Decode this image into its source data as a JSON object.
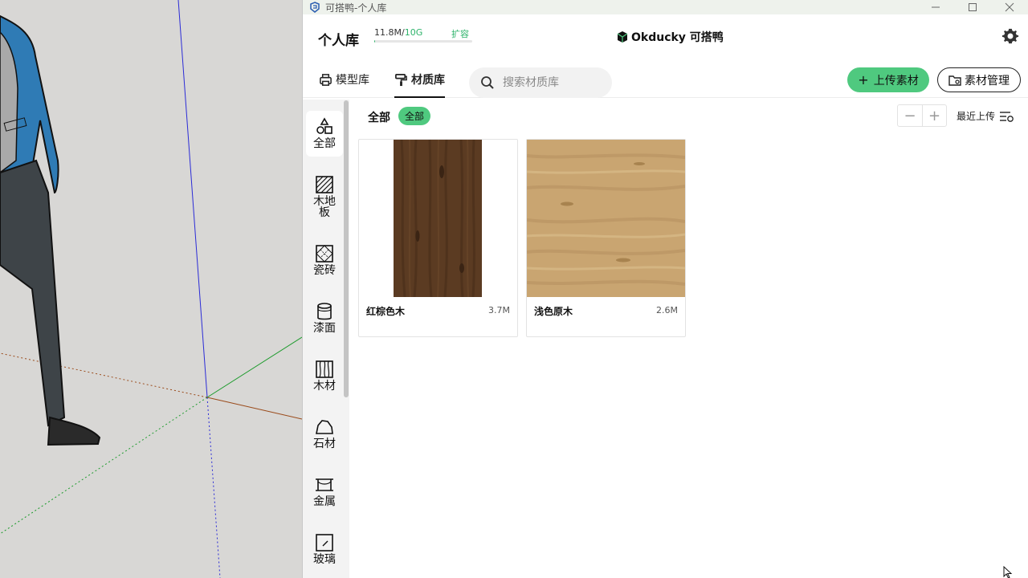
{
  "window": {
    "title": "可搭鸭-个人库",
    "controls": [
      "minimize-icon",
      "maximize-icon",
      "close-icon"
    ]
  },
  "header": {
    "title": "个人库",
    "storage_used": "11.8M",
    "storage_sep": "/",
    "storage_total": "10G",
    "storage_fraction": 0.0012,
    "expand_label": "扩容",
    "logo_text": "Okducky 可搭鸭",
    "settings_icon": "gear-icon"
  },
  "nav": {
    "tabs": [
      {
        "label": "模型库",
        "icon": "printer-icon",
        "active": false
      },
      {
        "label": "材质库",
        "icon": "paint-roller-icon",
        "active": true
      }
    ],
    "search_placeholder": "搜索材质库",
    "upload_label": "上传素材",
    "manage_label": "素材管理"
  },
  "sidebar": {
    "categories": [
      {
        "label": "全部",
        "icon": "shapes-icon",
        "active": true
      },
      {
        "label": "木地板",
        "icon": "wood-floor-icon",
        "active": false
      },
      {
        "label": "瓷砖",
        "icon": "tile-icon",
        "active": false
      },
      {
        "label": "漆面",
        "icon": "paint-can-icon",
        "active": false
      },
      {
        "label": "木材",
        "icon": "wood-grain-icon",
        "active": false
      },
      {
        "label": "石材",
        "icon": "stone-icon",
        "active": false
      },
      {
        "label": "金属",
        "icon": "metal-beam-icon",
        "active": false
      },
      {
        "label": "玻璃",
        "icon": "glass-icon",
        "active": false
      }
    ]
  },
  "content": {
    "filter_title": "全部",
    "filter_chip": "全部",
    "sort_label": "最近上传",
    "zoom_out": "−",
    "zoom_in": "+",
    "items": [
      {
        "name": "红棕色木",
        "size": "3.7M",
        "color": "#5b3b22"
      },
      {
        "name": "浅色原木",
        "size": "2.6M",
        "color": "#c9a571"
      }
    ]
  },
  "colors": {
    "accent": "#4fc97f",
    "accent_text": "#2db36a"
  }
}
